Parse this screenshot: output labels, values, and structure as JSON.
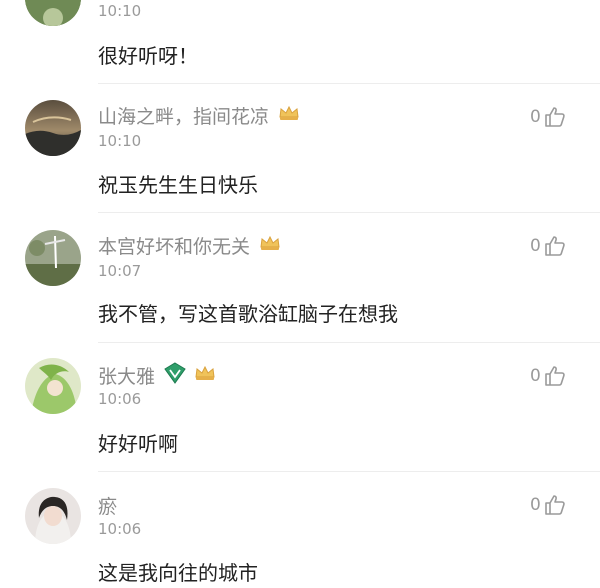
{
  "comments": [
    {
      "time": "10:10",
      "content": "很好听呀！",
      "avatar_icon": "avatar-photo-icon"
    },
    {
      "name": "山海之畔，指间花凉",
      "time": "10:10",
      "content": "祝玉先生生日快乐",
      "likes": "0",
      "badges": [
        "crown-badge-icon"
      ]
    },
    {
      "name": "本宫好坏和你无关",
      "time": "10:07",
      "content": "我不管，写这首歌浴缸脑子在想我",
      "likes": "0",
      "badges": [
        "crown-badge-icon"
      ]
    },
    {
      "name": "张大雅",
      "time": "10:06",
      "content": "好好听啊",
      "likes": "0",
      "badges": [
        "vip-badge-icon",
        "crown-badge-icon"
      ]
    },
    {
      "name": "瘀",
      "time": "10:06",
      "content": "这是我向往的城市",
      "likes": "0",
      "badges": []
    }
  ],
  "colors": {
    "name": "#8a8a8a",
    "time": "#9a9a9a",
    "content": "#222222",
    "badge_gold": "#e8b84a",
    "badge_green": "#2f9e6a"
  }
}
